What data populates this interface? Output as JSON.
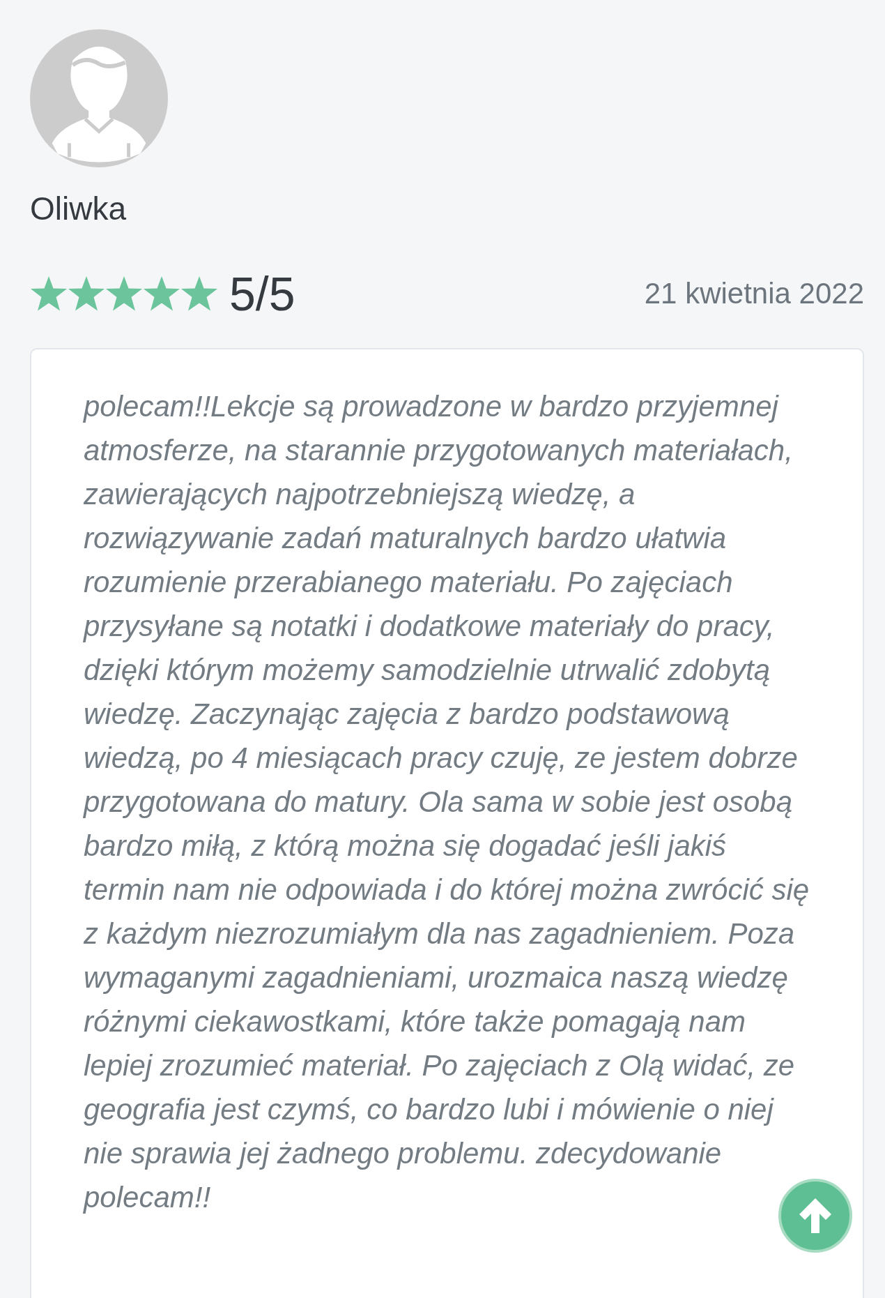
{
  "reviewer": {
    "name": "Oliwka"
  },
  "rating": {
    "stars": 5,
    "score": "5/5",
    "date": "21 kwietnia 2022"
  },
  "review": {
    "text": "polecam!!Lekcje są prowadzone w bardzo przyjemnej atmosferze, na starannie przygotowanych materiałach, zawierających najpotrzebniejszą wiedzę, a rozwiązywanie zadań maturalnych bardzo ułatwia rozumienie przerabianego materiału. Po zajęciach przysyłane są notatki i dodatkowe materiały do pracy, dzięki którym możemy samodzielnie utrwalić zdobytą wiedzę. Zaczynając zajęcia z bardzo podstawową wiedzą, po 4 miesiącach pracy czuję, ze jestem dobrze przygotowana do matury. Ola sama w sobie jest osobą bardzo miłą, z którą można się dogadać jeśli jakiś termin nam nie odpowiada i do której można zwrócić się z każdym niezrozumiałym dla nas zagadnieniem. Poza wymaganymi zagadnieniami, urozmaica naszą wiedzę różnymi ciekawostkami, które także pomagają nam lepiej zrozumieć materiał. Po zajęciach z Olą widać, ze geografia jest czymś, co bardzo lubi i mówienie o niej nie sprawia jej żadnego problemu. zdecydowanie polecam!!"
  }
}
